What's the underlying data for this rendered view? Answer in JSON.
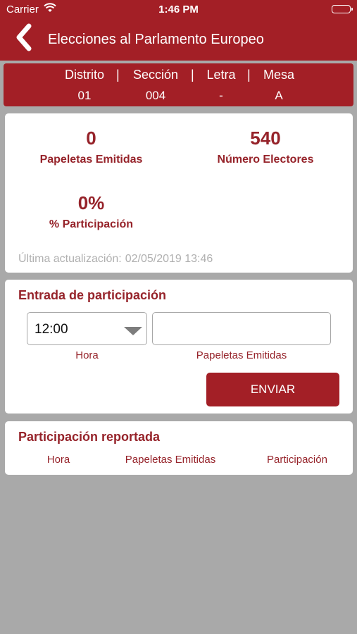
{
  "status_bar": {
    "carrier": "Carrier",
    "time": "1:46 PM",
    "wifi_icon": "wifi-icon",
    "battery_icon": "battery-icon",
    "battery_level": 1.0
  },
  "nav": {
    "back_icon": "chevron-left-icon",
    "title": "Elecciones al Parlamento Europeo"
  },
  "location": {
    "columns": [
      {
        "label": "Distrito",
        "value": "01"
      },
      {
        "label": "Sección",
        "value": "004"
      },
      {
        "label": "Letra",
        "value": "-"
      },
      {
        "label": "Mesa",
        "value": "A"
      }
    ],
    "separator": "|"
  },
  "stats": {
    "ballots_issued": {
      "value": "0",
      "label": "Papeletas Emitidas"
    },
    "voters": {
      "value": "540",
      "label": "Número Electores"
    },
    "participation": {
      "value": "0%",
      "label": "% Participación"
    },
    "updated_label": "Última actualización:",
    "updated_value": "02/05/2019 13:46"
  },
  "entry": {
    "title": "Entrada de participación",
    "hour_value": "12:00",
    "hour_caret_icon": "caret-down-icon",
    "ballots_value": "",
    "ballots_placeholder": "",
    "hour_caption": "Hora",
    "ballots_caption": "Papeletas Emitidas",
    "send_label": "ENVIAR"
  },
  "reported": {
    "title": "Participación reportada",
    "columns": [
      "Hora",
      "Papeletas Emitidas",
      "Participación"
    ]
  },
  "colors": {
    "brand": "#a31f26",
    "accent_text": "#96232a",
    "background": "#a9a9a9",
    "muted_text": "#b0b0b0"
  }
}
